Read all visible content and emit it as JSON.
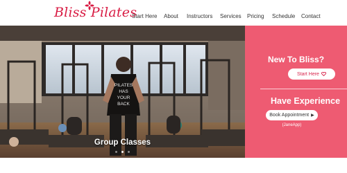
{
  "brand": {
    "logo_text": "Bliss Pilates"
  },
  "nav": {
    "items": [
      "Start Here",
      "About",
      "Instructors",
      "Services",
      "Pricing",
      "Schedule",
      "Contact"
    ]
  },
  "hero": {
    "caption": "Group Classes",
    "shirt_text": [
      "PILATES",
      "HAS",
      "YOUR",
      "BACK"
    ],
    "slide_count": 3,
    "active_slide": 1
  },
  "promo": {
    "new_title": "New To Bliss?",
    "start_button": "Start Here",
    "experienced_title": "Have Experience",
    "book_button": "Book Appointment",
    "booking_note": "(JaneApp)"
  },
  "colors": {
    "brand_red": "#d81b43",
    "panel_pink": "#ee5b72"
  }
}
